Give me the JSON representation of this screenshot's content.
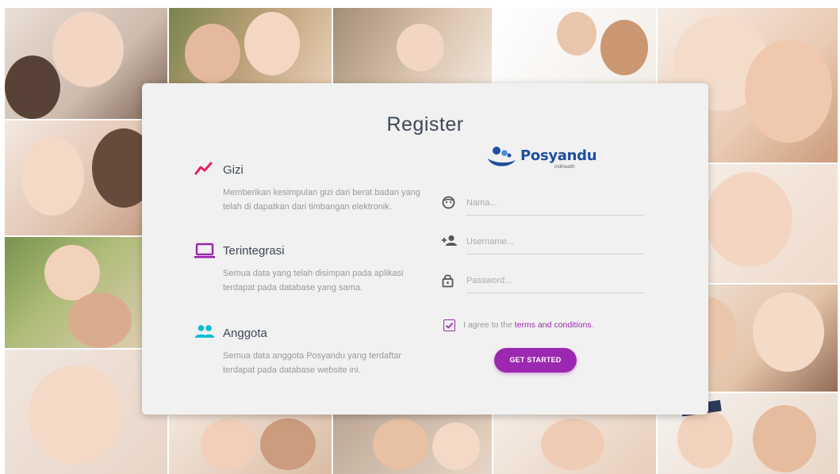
{
  "page": {
    "title": "Register"
  },
  "features": [
    {
      "icon": "trending-up-icon",
      "title": "Gizi",
      "description": "Memberikan kesimpulan gizi dari berat badan yang telah di dapatkan dari timbangan elektronik.",
      "color": "#e91e63"
    },
    {
      "icon": "laptop-icon",
      "title": "Terintegrasi",
      "description": "Semua data yang telah disimpan pada aplikasi terdapat pada database yang sama.",
      "color": "#9c27b0"
    },
    {
      "icon": "group-icon",
      "title": "Anggota",
      "description": "Semua data anggota Posyandu yang terdaftar terdapat pada database website ini.",
      "color": "#00bcd4"
    }
  ],
  "logo": {
    "name": "Posyandu",
    "tagline": "indihealth"
  },
  "form": {
    "name_placeholder": "Nama...",
    "username_placeholder": "Username...",
    "password_placeholder": "Password...",
    "agree_prefix": "I agree to the ",
    "agree_link": "terms and conditions",
    "agree_suffix": ".",
    "agree_checked": true,
    "submit_label": "GET STARTED"
  },
  "colors": {
    "primary": "#9c27b0",
    "card_bg": "#f1f1f1",
    "logo_blue": "#1f4fa0"
  }
}
